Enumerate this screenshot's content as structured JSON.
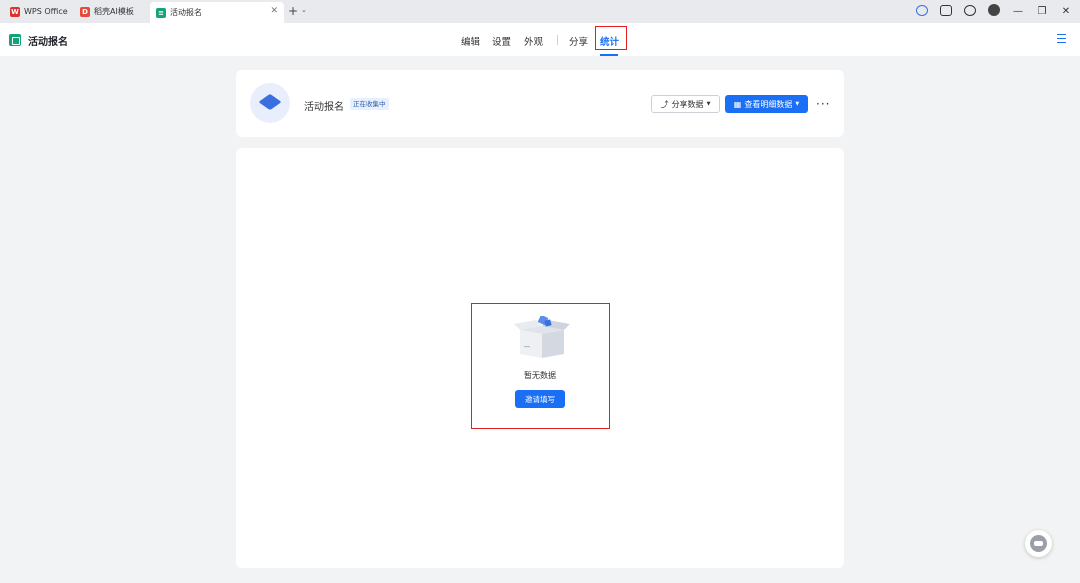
{
  "tabs": [
    {
      "label": "WPS Office",
      "icon": "wps-icon",
      "color": "#e03131"
    },
    {
      "label": "稻壳AI模板",
      "icon": "docer-icon",
      "color": "#e64a3c"
    },
    {
      "label": "活动报名",
      "icon": "form-icon",
      "color": "#12a37a"
    }
  ],
  "app": {
    "title": "活动报名"
  },
  "nav": {
    "edit": "编辑",
    "settings": "设置",
    "appearance": "外观",
    "share": "分享",
    "stats": "统计"
  },
  "form": {
    "name": "活动报名",
    "status": "正在收集中",
    "share_data_label": "分享数据",
    "view_detail_label": "查看明细数据",
    "more": "···"
  },
  "empty": {
    "text": "暂无数据",
    "invite_label": "邀请填写"
  },
  "colors": {
    "accent": "#1a6ff5",
    "highlight": "#e02020",
    "brand": "#12a37a"
  }
}
